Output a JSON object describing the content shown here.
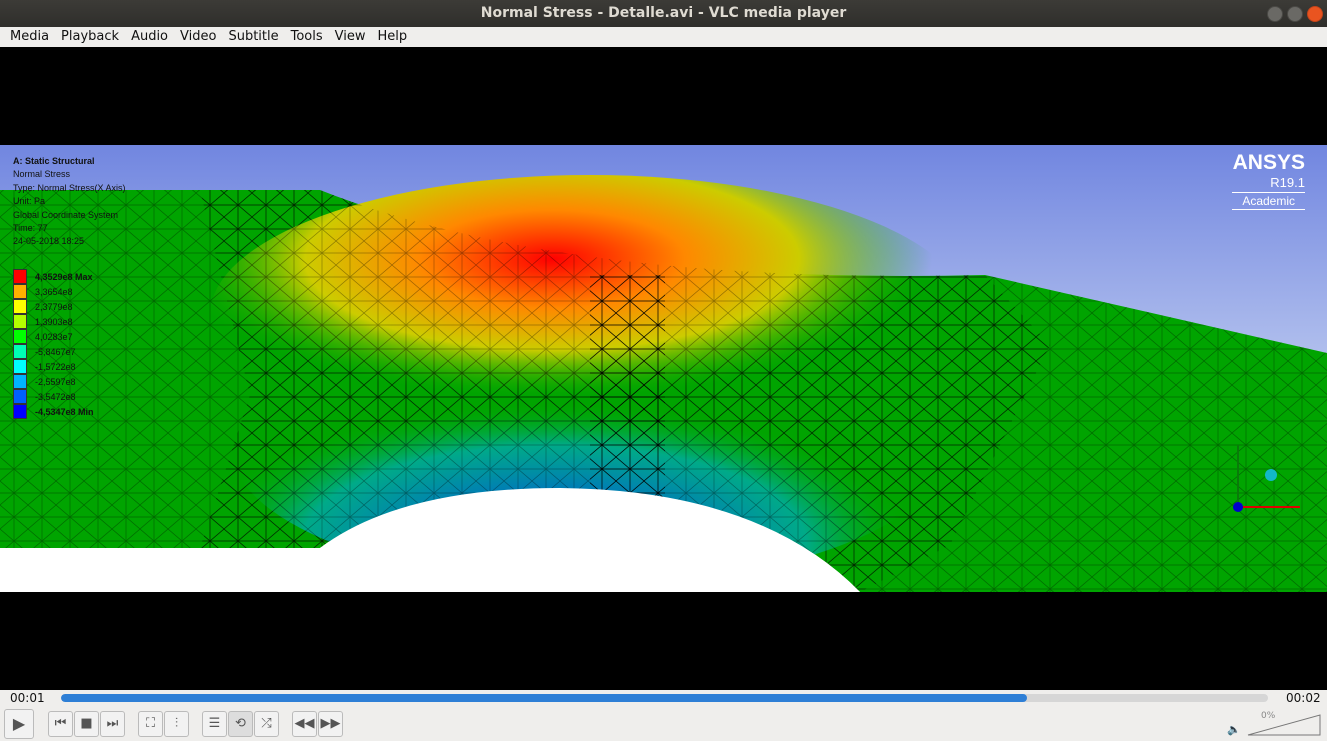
{
  "window": {
    "title": "Normal Stress - Detalle.avi - VLC media player"
  },
  "menu": [
    "Media",
    "Playback",
    "Audio",
    "Video",
    "Subtitle",
    "Tools",
    "View",
    "Help"
  ],
  "overlay": {
    "lines": [
      "A: Static Structural",
      "Normal Stress",
      "Type: Normal Stress(X Axis)",
      "Unit: Pa",
      "Global Coordinate System",
      "Time: 77",
      "24-05-2018 18:25"
    ]
  },
  "legend": [
    {
      "label": "4,3529e8 Max",
      "color": "#ff0000"
    },
    {
      "label": "3,3654e8",
      "color": "#ffb000"
    },
    {
      "label": "2,3779e8",
      "color": "#ffff00"
    },
    {
      "label": "1,3903e8",
      "color": "#b4ff00"
    },
    {
      "label": "4,0283e7",
      "color": "#00ff00"
    },
    {
      "label": "-5,8467e7",
      "color": "#00ffb4"
    },
    {
      "label": "-1,5722e8",
      "color": "#00ffff"
    },
    {
      "label": "-2,5597e8",
      "color": "#00b4ff"
    },
    {
      "label": "-3,5472e8",
      "color": "#0060ff"
    },
    {
      "label": "-4,5347e8 Min",
      "color": "#0000ff"
    }
  ],
  "branding": {
    "name": "ANSYS",
    "version": "R19.1",
    "edition": "Academic"
  },
  "playback": {
    "elapsed": "00:01",
    "total": "00:02",
    "progress": 0.8,
    "volume": "0%"
  },
  "colors": {
    "accent": "#2e7fd6",
    "close": "#e95420"
  }
}
